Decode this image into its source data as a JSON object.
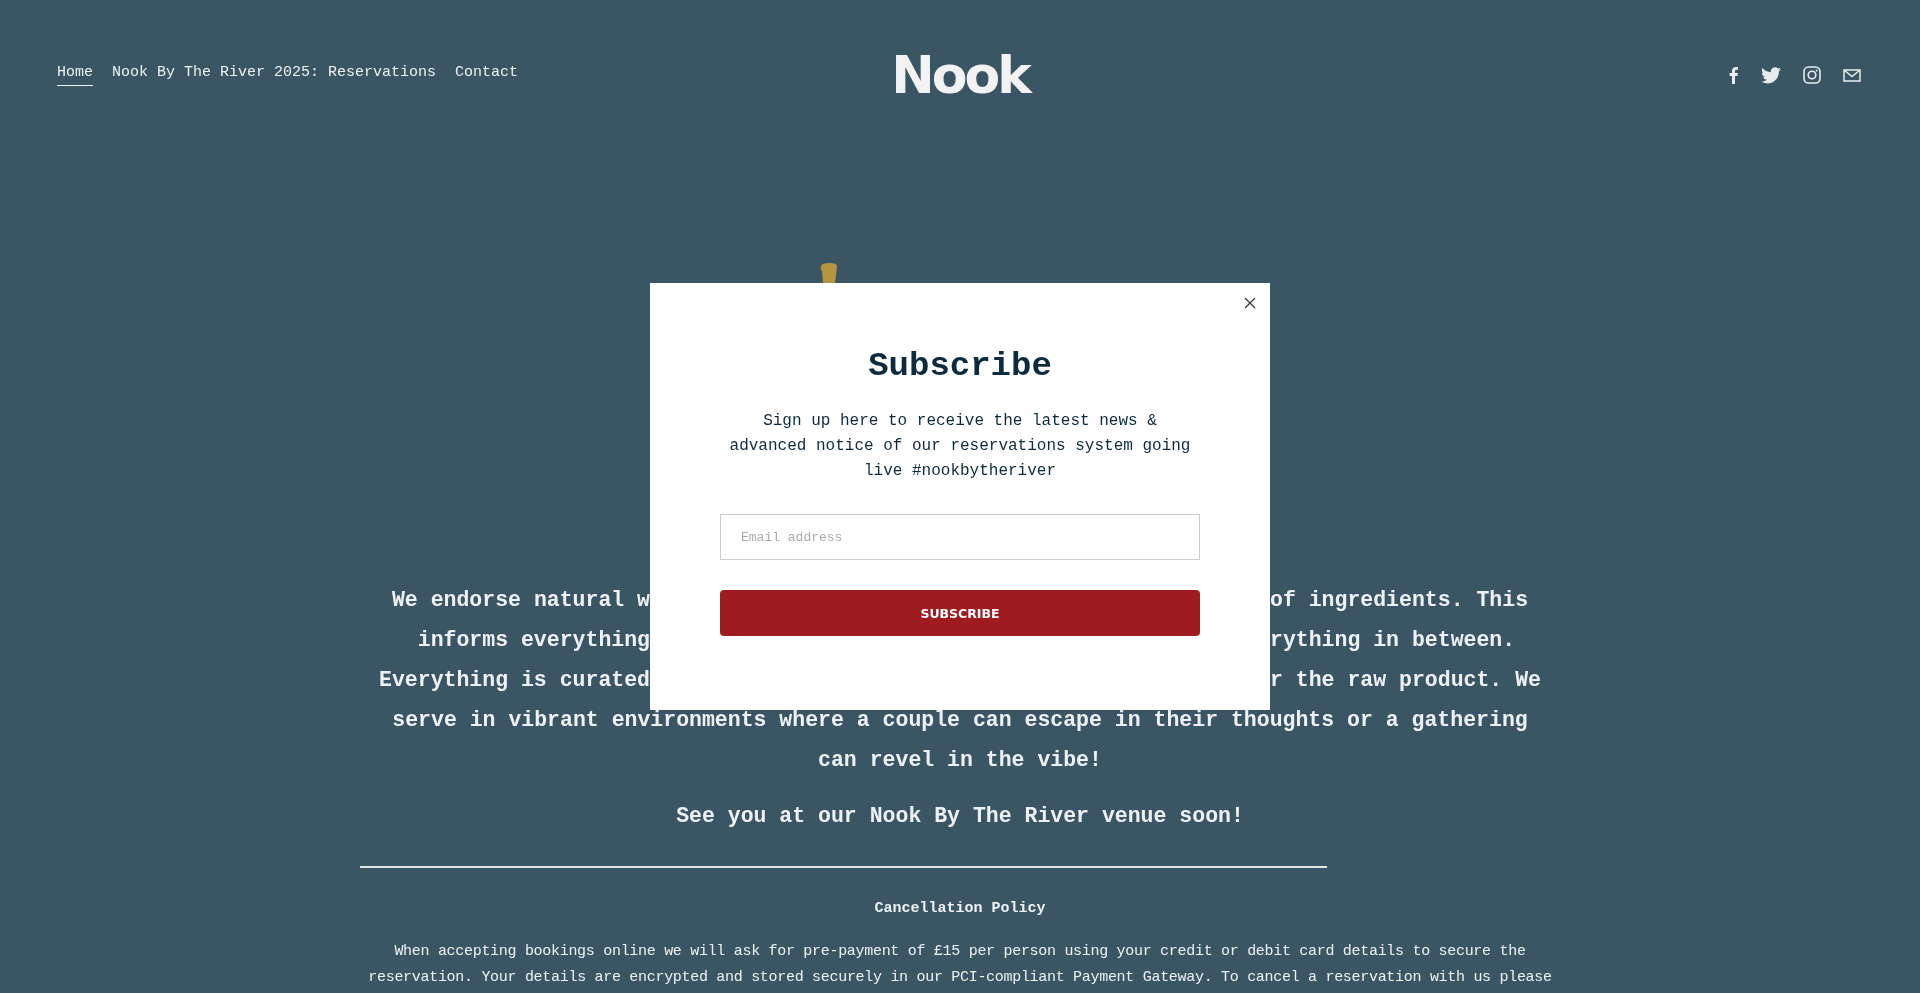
{
  "nav": {
    "links": [
      {
        "label": "Home",
        "selected": true
      },
      {
        "label": "Nook By The River 2025: Reservations",
        "selected": false
      },
      {
        "label": "Contact",
        "selected": false
      }
    ],
    "logo": "Nook",
    "social": [
      {
        "kind": "facebook"
      },
      {
        "kind": "twitter"
      },
      {
        "kind": "instagram"
      },
      {
        "kind": "email"
      }
    ]
  },
  "intro": {
    "partial_lines": [
      {
        "left": "We endorse natural w",
        "right": "of ingredients. This"
      },
      {
        "left": "informs everything",
        "right": "rything in between."
      },
      {
        "left": "Everything is curated",
        "right": "r the raw product. We"
      }
    ],
    "lines": [
      "serve in vibrant environments where a couple can escape in their thoughts or a gathering",
      "can revel in the vibe!"
    ],
    "closing": "See you at our Nook By The River venue soon!"
  },
  "policy": {
    "heading": "Cancellation Policy",
    "text": "When accepting bookings online we will ask for pre-payment of £15 per person using your credit or debit card details to secure the reservation. Your details are encrypted and stored securely in our PCI-compliant Payment Gateway. To cancel a reservation with us please"
  },
  "modal": {
    "title": "Subscribe",
    "description": "Sign up here to receive the latest news & advanced notice of our reservations system going live #nookbytheriver",
    "email": {
      "placeholder": "Email address"
    },
    "button": "SUBSCRIBE"
  }
}
